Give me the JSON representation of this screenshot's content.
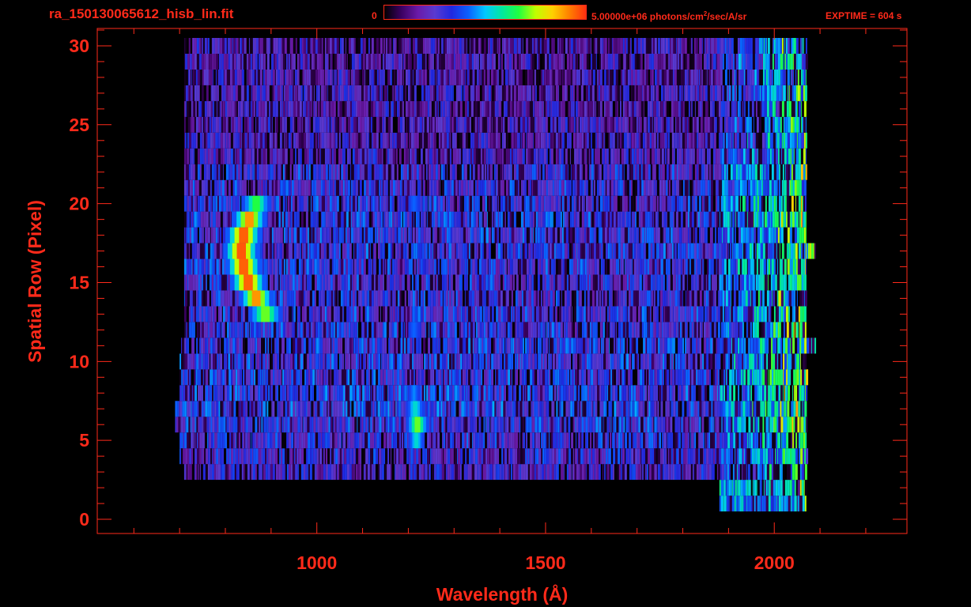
{
  "header": {
    "filename": "ra_150130065612_hisb_lin.fit",
    "colorbar_min_label": "0",
    "colorbar_max_value": "5.00000e+06",
    "colorbar_units_pre": "photons/cm",
    "colorbar_units_sup": "2",
    "colorbar_units_post": "/sec/A/sr",
    "exptime_text": "EXPTIME = 604 s"
  },
  "colors": {
    "axis": "#ff2a1a",
    "background": "#000000",
    "colormap": [
      "#000000",
      "#3a0060",
      "#6a1aa8",
      "#5a3ad0",
      "#2028e0",
      "#0a60ff",
      "#00c8ff",
      "#00e8a0",
      "#20ff40",
      "#c0ff00",
      "#ffd000",
      "#ff8000",
      "#ff3010"
    ]
  },
  "chart_data": {
    "type": "heatmap",
    "title": "ra_150130065612_hisb_lin.fit",
    "xlabel": "Wavelength (Å)",
    "ylabel": "Spatial Row (Pixel)",
    "xlim": [
      520,
      2290
    ],
    "ylim": [
      -0.9,
      31.1
    ],
    "x_ticks": [
      1000,
      1500,
      2000
    ],
    "y_ticks": [
      0,
      5,
      10,
      15,
      20,
      25,
      30
    ],
    "colorbar_range": [
      0,
      5000000
    ],
    "colorbar_units": "photons/cm^2/sec/A/sr",
    "background_rows": [
      {
        "row": 1,
        "x_start": 1880,
        "x_end": 2070,
        "base": 0.45
      },
      {
        "row": 2,
        "x_start": 1880,
        "x_end": 2070,
        "base": 0.48
      },
      {
        "row": 3,
        "x_start": 710,
        "x_end": 2070,
        "base": 0.25
      },
      {
        "row": 4,
        "x_start": 700,
        "x_end": 2070,
        "base": 0.28
      },
      {
        "row": 5,
        "x_start": 700,
        "x_end": 2070,
        "base": 0.3
      },
      {
        "row": 6,
        "x_start": 690,
        "x_end": 2070,
        "base": 0.32
      },
      {
        "row": 7,
        "x_start": 690,
        "x_end": 2070,
        "base": 0.34
      },
      {
        "row": 8,
        "x_start": 700,
        "x_end": 2070,
        "base": 0.33
      },
      {
        "row": 9,
        "x_start": 700,
        "x_end": 2070,
        "base": 0.32
      },
      {
        "row": 10,
        "x_start": 700,
        "x_end": 2070,
        "base": 0.32
      },
      {
        "row": 11,
        "x_start": 700,
        "x_end": 2090,
        "base": 0.32
      },
      {
        "row": 12,
        "x_start": 710,
        "x_end": 2070,
        "base": 0.31
      },
      {
        "row": 13,
        "x_start": 710,
        "x_end": 2070,
        "base": 0.31
      },
      {
        "row": 14,
        "x_start": 710,
        "x_end": 2070,
        "base": 0.3
      },
      {
        "row": 15,
        "x_start": 710,
        "x_end": 2070,
        "base": 0.3
      },
      {
        "row": 16,
        "x_start": 710,
        "x_end": 2070,
        "base": 0.31
      },
      {
        "row": 17,
        "x_start": 710,
        "x_end": 2090,
        "base": 0.32
      },
      {
        "row": 18,
        "x_start": 710,
        "x_end": 2070,
        "base": 0.32
      },
      {
        "row": 19,
        "x_start": 710,
        "x_end": 2070,
        "base": 0.32
      },
      {
        "row": 20,
        "x_start": 710,
        "x_end": 2070,
        "base": 0.31
      },
      {
        "row": 21,
        "x_start": 710,
        "x_end": 2070,
        "base": 0.3
      },
      {
        "row": 22,
        "x_start": 710,
        "x_end": 2070,
        "base": 0.3
      },
      {
        "row": 23,
        "x_start": 710,
        "x_end": 2070,
        "base": 0.24
      },
      {
        "row": 24,
        "x_start": 710,
        "x_end": 2070,
        "base": 0.22
      },
      {
        "row": 25,
        "x_start": 710,
        "x_end": 2070,
        "base": 0.22
      },
      {
        "row": 26,
        "x_start": 710,
        "x_end": 2070,
        "base": 0.22
      },
      {
        "row": 27,
        "x_start": 710,
        "x_end": 2070,
        "base": 0.22
      },
      {
        "row": 28,
        "x_start": 710,
        "x_end": 2070,
        "base": 0.22
      },
      {
        "row": 29,
        "x_start": 710,
        "x_end": 2070,
        "base": 0.22
      },
      {
        "row": 30,
        "x_start": 710,
        "x_end": 2070,
        "base": 0.22
      }
    ],
    "features": [
      {
        "name": "bright arc",
        "rows": [
          {
            "row": 13,
            "x_start": 850,
            "x_end": 925,
            "peak": 0.72
          },
          {
            "row": 14,
            "x_start": 830,
            "x_end": 905,
            "peak": 0.92
          },
          {
            "row": 15,
            "x_start": 810,
            "x_end": 890,
            "peak": 0.98
          },
          {
            "row": 16,
            "x_start": 800,
            "x_end": 880,
            "peak": 0.98
          },
          {
            "row": 17,
            "x_start": 795,
            "x_end": 875,
            "peak": 0.99
          },
          {
            "row": 18,
            "x_start": 800,
            "x_end": 880,
            "peak": 0.98
          },
          {
            "row": 19,
            "x_start": 815,
            "x_end": 890,
            "peak": 0.92
          },
          {
            "row": 20,
            "x_start": 835,
            "x_end": 900,
            "peak": 0.68
          }
        ]
      },
      {
        "name": "line near 1216",
        "rows": [
          {
            "row": 5,
            "x_start": 1200,
            "x_end": 1235,
            "peak": 0.55
          },
          {
            "row": 6,
            "x_start": 1195,
            "x_end": 1245,
            "peak": 0.72
          },
          {
            "row": 7,
            "x_start": 1195,
            "x_end": 1235,
            "peak": 0.55
          }
        ]
      },
      {
        "name": "column near 1216",
        "rows": [
          {
            "row": 8,
            "x_start": 1200,
            "x_end": 1225,
            "peak": 0.45
          },
          {
            "row": 12,
            "x_start": 1200,
            "x_end": 1225,
            "peak": 0.42
          },
          {
            "row": 20,
            "x_start": 1200,
            "x_end": 1225,
            "peak": 0.42
          }
        ]
      }
    ]
  }
}
